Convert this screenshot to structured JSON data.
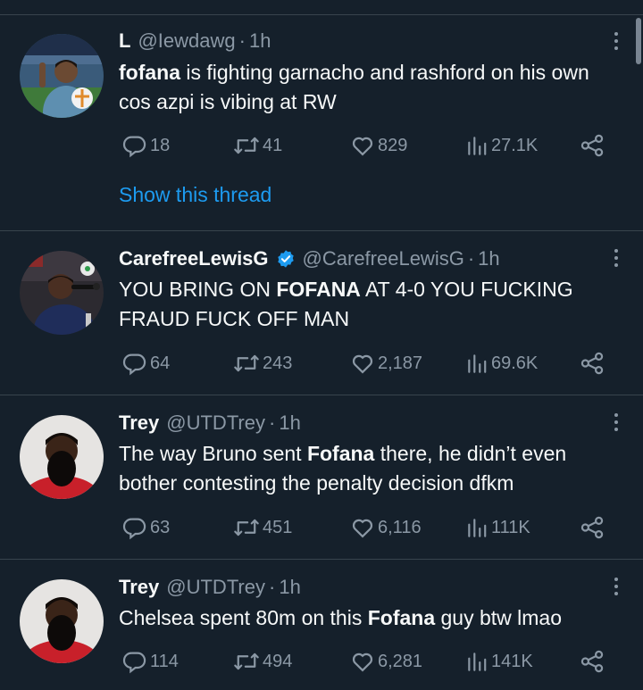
{
  "tweets": [
    {
      "name": "L",
      "handle": "@Iewdawg",
      "time": "1h",
      "verified": false,
      "text_bold": "fofana",
      "text_rest": " is fighting garnacho and rashford on his own cos azpi is vibing at RW",
      "replies": "18",
      "retweets": "41",
      "likes": "829",
      "views": "27.1K",
      "show_thread": "Show this thread"
    },
    {
      "name": "CarefreeLewisG",
      "handle": "@CarefreeLewisG",
      "time": "1h",
      "verified": true,
      "text_pre": "YOU BRING ON ",
      "text_bold": "FOFANA",
      "text_rest": " AT 4-0 YOU FUCKING FRAUD FUCK OFF MAN",
      "replies": "64",
      "retweets": "243",
      "likes": "2,187",
      "views": "69.6K"
    },
    {
      "name": "Trey",
      "handle": "@UTDTrey",
      "time": "1h",
      "verified": false,
      "text_pre": "The way Bruno sent ",
      "text_bold": "Fofana",
      "text_rest": " there, he didn’t even bother contesting the penalty decision dfkm",
      "replies": "63",
      "retweets": "451",
      "likes": "6,116",
      "views": "111K"
    },
    {
      "name": "Trey",
      "handle": "@UTDTrey",
      "time": "1h",
      "verified": false,
      "text_pre": "Chelsea spent 80m on this ",
      "text_bold": "Fofana",
      "text_rest": " guy btw lmao",
      "replies": "114",
      "retweets": "494",
      "likes": "6,281",
      "views": "141K"
    }
  ],
  "separator": "·",
  "colors": {
    "background": "#15202b",
    "text": "#f7f9f9",
    "muted": "#8b98a5",
    "link": "#1d9bf0",
    "border": "#38444d"
  }
}
